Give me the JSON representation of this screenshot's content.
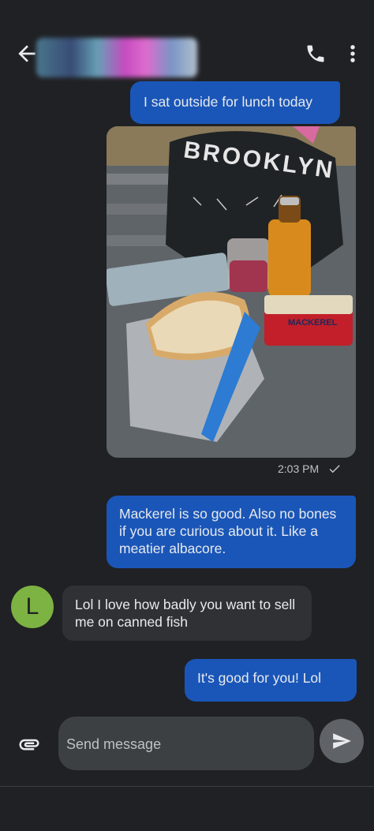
{
  "header": {
    "back_icon": "arrow-back-icon",
    "contact_name_obscured": true,
    "call_icon": "phone-icon",
    "menu_icon": "more-vert-icon"
  },
  "messages": [
    {
      "direction": "outgoing",
      "text": "I sat outside for lunch today"
    },
    {
      "direction": "outgoing",
      "type": "photo",
      "caption": "",
      "photo_texts": [
        "BROOKLYN",
        "MACKEREL"
      ]
    },
    {
      "direction": "outgoing",
      "text": "Mackerel is so good. Also no bones if you are curious about it. Like a meatier albacore."
    },
    {
      "direction": "incoming",
      "avatar_letter": "L",
      "text": "Lol I love how badly you want to sell me on canned fish"
    },
    {
      "direction": "outgoing",
      "text": "It's good for you! Lol"
    }
  ],
  "photo_status": {
    "time": "2:03 PM",
    "status_icon": "check-icon"
  },
  "compose": {
    "placeholder": "Send message",
    "value": "",
    "attach_icon": "attachment-icon",
    "send_icon": "send-icon"
  },
  "colors": {
    "background": "#202124",
    "outgoing_bubble": "#1a56b8",
    "incoming_bubble": "#303134",
    "avatar": "#7cb342"
  }
}
